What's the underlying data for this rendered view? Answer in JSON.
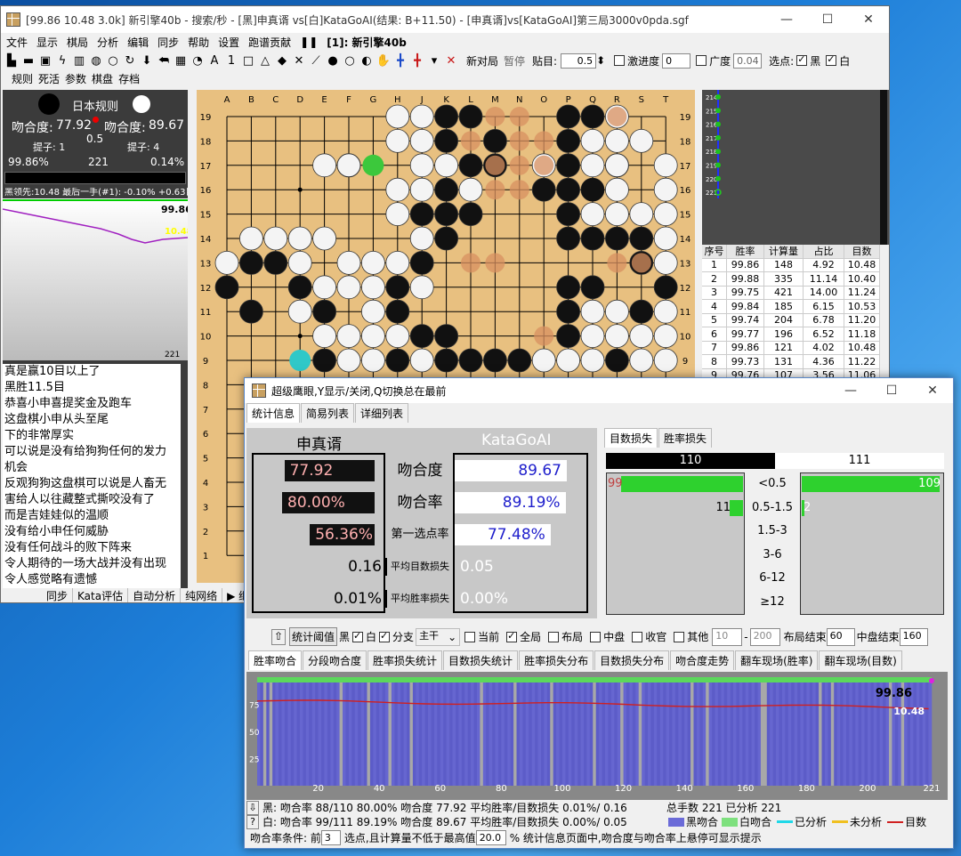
{
  "main": {
    "title": "[99.86 10.48 3.0k] 新引擎40b - 搜索/秒 - [黑]申真谞 vs[白]KataGoAI(结果: B+11.50) - [申真谞]vs[KataGoAI]第三局3000v0pda.sgf",
    "menu": [
      "文件",
      "显示",
      "棋局",
      "分析",
      "编辑",
      "同步",
      "帮助",
      "设置",
      "跑谱贡献",
      "❚❚",
      "[1]: 新引擎40b"
    ],
    "toolbar": {
      "new_game": "新对局",
      "pause": "暂停",
      "komi_label": "贴目:",
      "komi": "0.5",
      "aggr_label": "激进度",
      "aggr": "0",
      "width_label": "广度",
      "width": "0.04",
      "select_label": "选点:",
      "black": "黑",
      "white": "白"
    },
    "toolbar2": [
      "规则",
      "死活",
      "参数",
      "棋盘",
      "存档"
    ],
    "left": {
      "rule": "日本规则",
      "b_match_label": "吻合度:",
      "b_match": "77.92",
      "w_match_label": "吻合度:",
      "w_match": "89.67",
      "komi": "0.5",
      "b_capt": "提子: 1",
      "w_capt": "提子: 4",
      "b_win": "99.86%",
      "move": "221",
      "w_win": "0.14%",
      "status": "黑领先:10.48 最后一手(#1): -0.10% +0.63目",
      "graph_win": "99.86",
      "graph_score": "10.48",
      "graph_move": "221"
    },
    "chat": [
      "真是赢10目以上了",
      "黑胜11.5目",
      "恭喜小申喜提奖金及跑车",
      "这盘棋小申从头至尾",
      "下的非常厚实",
      "可以说是没有给狗狗任何的发力",
      "机会",
      "反观狗狗这盘棋可以说是人畜无",
      "害给人以往藏整式撕咬没有了",
      "而是吉娃娃似的温顺",
      "没有给小申任何威胁",
      "没有任何战斗的败下阵来",
      "令人期待的一场大战并没有出现",
      "令人感觉略有遗憾"
    ],
    "bottom": [
      "同步",
      "Kata评估",
      "自动分析",
      "纯网络",
      "▶ 继"
    ],
    "cols": [
      "A",
      "B",
      "C",
      "D",
      "E",
      "F",
      "G",
      "H",
      "J",
      "K",
      "L",
      "M",
      "N",
      "O",
      "P",
      "Q",
      "R",
      "S",
      "T"
    ],
    "rows": [
      "19",
      "18",
      "17",
      "16",
      "15",
      "14",
      "13",
      "12",
      "11",
      "10",
      "9",
      "8",
      "7",
      "6",
      "5",
      "4",
      "3",
      "2",
      "1"
    ],
    "table": {
      "headers": [
        "序号",
        "胜率",
        "计算量",
        "占比",
        "目数"
      ],
      "rows": [
        [
          "1",
          "99.86",
          "148",
          "4.92",
          "10.48"
        ],
        [
          "2",
          "99.88",
          "335",
          "11.14",
          "10.40"
        ],
        [
          "3",
          "99.75",
          "421",
          "14.00",
          "11.24"
        ],
        [
          "4",
          "99.84",
          "185",
          "6.15",
          "10.53"
        ],
        [
          "5",
          "99.74",
          "204",
          "6.78",
          "11.20"
        ],
        [
          "6",
          "99.77",
          "196",
          "6.52",
          "11.18"
        ],
        [
          "7",
          "99.86",
          "121",
          "4.02",
          "10.48"
        ],
        [
          "8",
          "99.73",
          "131",
          "4.36",
          "11.22"
        ],
        [
          "9",
          "99.76",
          "107",
          "3.56",
          "11.06"
        ]
      ]
    },
    "branch": [
      "214",
      "215",
      "216",
      "217",
      "218",
      "219",
      "220",
      "221"
    ]
  },
  "dlg": {
    "title": "超级鹰眼,Y显示/关闭,Q切换总在最前",
    "tabs": [
      "统计信息",
      "简易列表",
      "详细列表"
    ],
    "black_name": "申真谞",
    "white_name": "KataGoAI",
    "rows": [
      {
        "label": "吻合度",
        "b": "77.92",
        "w": "89.67",
        "bf": 0.78,
        "wf": 0.9
      },
      {
        "label": "吻合率",
        "b": "80.00%",
        "w": "89.19%",
        "bf": 0.8,
        "wf": 0.89
      },
      {
        "label": "第一选点率",
        "b": "56.36%",
        "w": "77.48%",
        "bf": 0.56,
        "wf": 0.77
      },
      {
        "label": "平均目数损失",
        "b": "0.16",
        "w": "0.05"
      },
      {
        "label": "平均胜率损失",
        "b": "0.01%",
        "w": "0.00%"
      }
    ],
    "loss_tabs": [
      "目数损失",
      "胜率损失"
    ],
    "loss": {
      "b_total": "110",
      "w_total": "111",
      "cats": [
        "<0.5",
        "0.5-1.5",
        "1.5-3",
        "3-6",
        "6-12",
        "≥12"
      ],
      "b": [
        "99",
        "11",
        "",
        "",
        "",
        ""
      ],
      "w": [
        "109",
        "2",
        "",
        "",
        "",
        ""
      ],
      "bf": [
        0.9,
        0.1,
        0,
        0,
        0,
        0
      ],
      "wf": [
        0.98,
        0.02,
        0,
        0,
        0,
        0
      ]
    },
    "opts": {
      "thresh": "统计阈值",
      "black": "黑",
      "white": "白",
      "branch": "分支",
      "trunk": "主干",
      "current": "当前",
      "whole": "全局",
      "opening": "布局",
      "middle": "中盘",
      "endgame": "收官",
      "other": "其他",
      "from": "10",
      "to": "200",
      "open_end": "布局结束",
      "open_end_v": "60",
      "mid_end": "中盘结束",
      "mid_end_v": "160"
    },
    "ctabs": [
      "胜率吻合",
      "分段吻合度",
      "胜率损失统计",
      "目数损失统计",
      "胜率损失分布",
      "目数损失分布",
      "吻合度走势",
      "翻车现场(胜率)",
      "翻车现场(目数)"
    ],
    "chart": {
      "y_ticks": [
        "75",
        "50",
        "25"
      ],
      "x_ticks": [
        "20",
        "40",
        "60",
        "80",
        "100",
        "120",
        "140",
        "160",
        "180",
        "200",
        "221"
      ],
      "win": "99.86",
      "score": "10.48"
    },
    "chart_data": {
      "type": "bar",
      "xlim": [
        0,
        221
      ],
      "ylim": [
        0,
        100
      ],
      "win_rate_last": 99.86,
      "score_last": 10.48,
      "series": [
        {
          "name": "黑吻合"
        },
        {
          "name": "白吻合"
        },
        {
          "name": "已分析"
        },
        {
          "name": "未分析"
        },
        {
          "name": "目数"
        }
      ]
    },
    "foot": {
      "b": "黑: 吻合率 88/110 80.00% 吻合度 77.92 平均胜率/目数损失 0.01%/ 0.16",
      "w": "白: 吻合率 99/111 89.19% 吻合度 89.67 平均胜率/目数损失 0.00%/ 0.05",
      "total": "总手数 221 已分析 221",
      "legend": [
        "黑吻合",
        "白吻合",
        "已分析",
        "未分析",
        "目数"
      ],
      "cond_a": "吻合率条件: 前",
      "cond_n": "3",
      "cond_b": "选点,且计算量不低于最高值",
      "cond_p": "20.0",
      "cond_c": "%   统计信息页面中,吻合度与吻合率上悬停可显示提示"
    }
  }
}
